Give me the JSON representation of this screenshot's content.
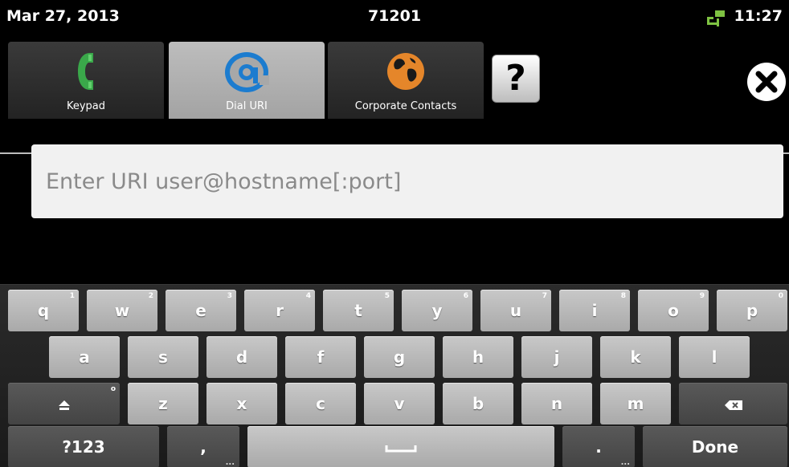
{
  "status_bar": {
    "date": "Mar 27, 2013",
    "extension": "71201",
    "time": "11:27",
    "signal_icon": "network-signal-icon",
    "signal_color": "#7ec242"
  },
  "tabs": [
    {
      "label": "Keypad",
      "icon": "phone-icon",
      "active": false
    },
    {
      "label": "Dial URI",
      "icon": "at-sign-icon",
      "active": true
    },
    {
      "label": "Corporate Contacts",
      "icon": "globe-icon",
      "active": false
    }
  ],
  "help": {
    "label": "?"
  },
  "close": {
    "icon": "close-icon"
  },
  "uri_field": {
    "placeholder": "Enter URI user@hostname[:port]",
    "value": ""
  },
  "keyboard": {
    "row1": [
      {
        "label": "q",
        "hint": "1"
      },
      {
        "label": "w",
        "hint": "2"
      },
      {
        "label": "e",
        "hint": "3"
      },
      {
        "label": "r",
        "hint": "4"
      },
      {
        "label": "t",
        "hint": "5"
      },
      {
        "label": "y",
        "hint": "6"
      },
      {
        "label": "u",
        "hint": "7"
      },
      {
        "label": "i",
        "hint": "8"
      },
      {
        "label": "o",
        "hint": "9"
      },
      {
        "label": "p",
        "hint": "0"
      }
    ],
    "row2": [
      "a",
      "s",
      "d",
      "f",
      "g",
      "h",
      "j",
      "k",
      "l"
    ],
    "row3": [
      "z",
      "x",
      "c",
      "v",
      "b",
      "n",
      "m"
    ],
    "shift_hint": "o",
    "symbols_label": "?123",
    "comma_label": ",",
    "period_label": ".",
    "more_hint": "...",
    "done_label": "Done"
  }
}
